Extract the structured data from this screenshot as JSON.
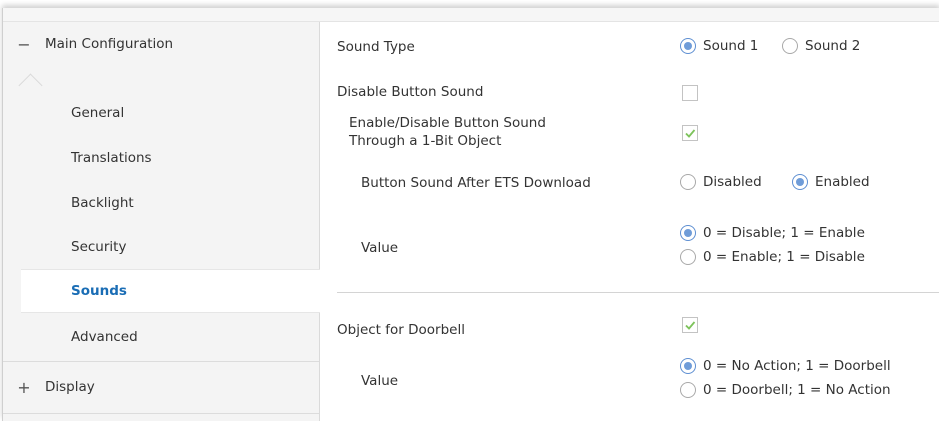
{
  "sidebar": {
    "main_group": {
      "label": "Main Configuration",
      "toggle": "−"
    },
    "items": [
      {
        "label": "General"
      },
      {
        "label": "Translations"
      },
      {
        "label": "Backlight"
      },
      {
        "label": "Security"
      },
      {
        "label": "Sounds"
      },
      {
        "label": "Advanced"
      }
    ],
    "active_item": "Sounds",
    "display_group": {
      "label": "Display",
      "toggle": "+"
    }
  },
  "params": {
    "sound_type": {
      "label": "Sound Type",
      "options": [
        "Sound 1",
        "Sound 2"
      ],
      "selected": "Sound 1"
    },
    "disable_button_sound": {
      "label": "Disable Button Sound",
      "checked": false
    },
    "enable_disable_obj": {
      "label_line1": "Enable/Disable Button Sound",
      "label_line2": "Through a 1-Bit Object",
      "checked": true
    },
    "after_download": {
      "label": "Button Sound After ETS Download",
      "options": [
        "Disabled",
        "Enabled"
      ],
      "selected": "Enabled"
    },
    "value1": {
      "label": "Value",
      "options": [
        "0 = Disable; 1 = Enable",
        "0 = Enable; 1 = Disable"
      ],
      "selected": "0 = Disable; 1 = Enable"
    },
    "doorbell": {
      "label": "Object for Doorbell",
      "checked": true
    },
    "value2": {
      "label": "Value",
      "options": [
        "0 = No Action; 1 = Doorbell",
        "0 = Doorbell; 1 = No Action"
      ],
      "selected": "0 = No Action; 1 = Doorbell"
    }
  },
  "colors": {
    "accent": "#1a6db5",
    "radio_selected": "#6f9cd8",
    "check": "#7dc35b"
  }
}
